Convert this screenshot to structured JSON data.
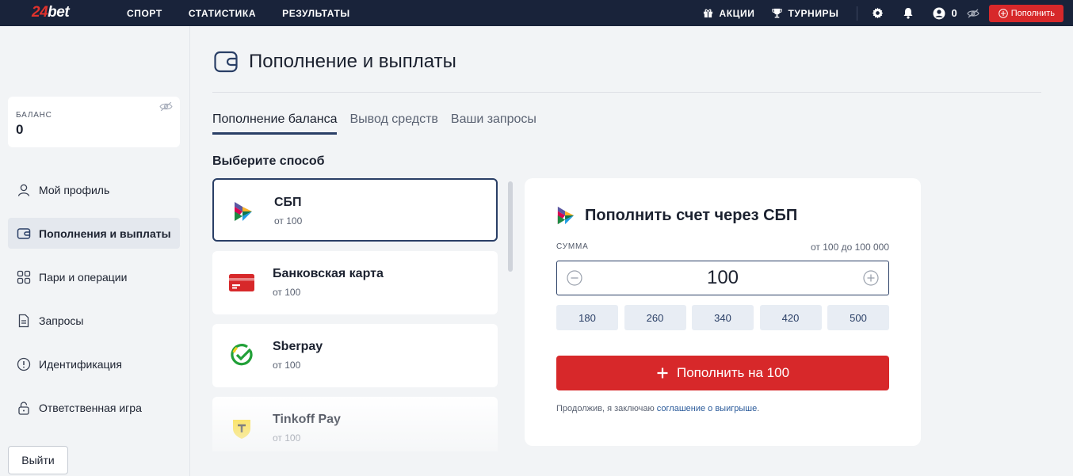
{
  "topbar": {
    "logo_num": "24",
    "logo_text": "bet",
    "nav": [
      "СПОРТ",
      "СТАТИСТИКА",
      "РЕЗУЛЬТАТЫ"
    ],
    "promo": "АКЦИИ",
    "tournaments": "ТУРНИРЫ",
    "balance": "0",
    "topup": "Пополнить"
  },
  "sidebar": {
    "balance_label": "БАЛАНС",
    "balance_value": "0",
    "items": [
      {
        "label": "Мой профиль",
        "icon": "user-icon"
      },
      {
        "label": "Пополнения и выплаты",
        "icon": "wallet-icon"
      },
      {
        "label": "Пари и операции",
        "icon": "grid-icon"
      },
      {
        "label": "Запросы",
        "icon": "document-icon"
      },
      {
        "label": "Идентификация",
        "icon": "info-icon"
      },
      {
        "label": "Ответственная игра",
        "icon": "lock-icon"
      }
    ],
    "logout": "Выйти"
  },
  "main": {
    "title": "Пополнение и выплаты",
    "tabs": [
      "Пополнение баланса",
      "Вывод средств",
      "Ваши запросы"
    ],
    "choose": "Выберите способ",
    "methods": [
      {
        "name": "СБП",
        "min": "от 100"
      },
      {
        "name": "Банковская карта",
        "min": "от 100"
      },
      {
        "name": "Sberpay",
        "min": "от 100"
      },
      {
        "name": "Tinkoff Pay",
        "min": "от 100"
      }
    ]
  },
  "panel": {
    "title": "Пополнить счет через СБП",
    "sum_label": "СУММА",
    "range": "от 100 до 100 000",
    "amount": "100",
    "presets": [
      "180",
      "260",
      "340",
      "420",
      "500"
    ],
    "submit": "Пополнить на 100",
    "terms_prefix": "Продолжив, я заключаю",
    "terms_link": "соглашение о выигрыше",
    "terms_suffix": "."
  },
  "colors": {
    "accent": "#d7282a",
    "navy": "#19233a",
    "selected_border": "#2a3f66"
  }
}
